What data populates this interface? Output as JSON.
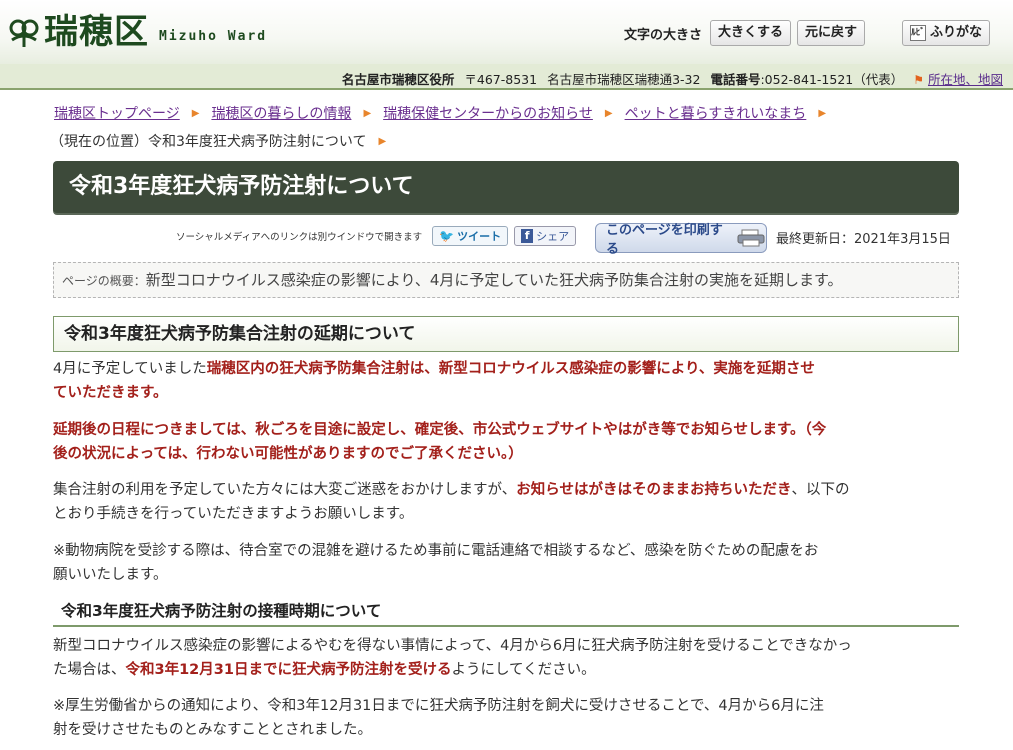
{
  "header": {
    "logo_title": "瑞穂区",
    "logo_sub": "Mizuho Ward",
    "textsize_label": "文字の大きさ",
    "enlarge_label": "大きくする",
    "reset_label": "元に戻す",
    "furigana_icon": "ﾙﾋﾞ",
    "furigana_label": "ふりがな"
  },
  "infobar": {
    "office": "名古屋市瑞穂区役所",
    "postal": "〒467-8531",
    "address": "名古屋市瑞穂区瑞穂通3-32",
    "phone_label": "電話番号",
    "phone": ":052-841-1521（代表）",
    "map_link": "所在地、地図"
  },
  "breadcrumb": {
    "items": [
      "瑞穂区トップページ",
      "瑞穂区の暮らしの情報",
      "瑞穂保健センターからのお知らせ",
      "ペットと暮らすきれいなまち"
    ],
    "current": "（現在の位置）令和3年度狂犬病予防注射について"
  },
  "page_title": "令和3年度狂犬病予防注射について",
  "social": {
    "note": "ソーシャルメディアへのリンクは別ウインドウで開きます",
    "tweet": "ツイート",
    "share": "シェア",
    "print": "このページを印刷する",
    "updated": "最終更新日：2021年3月15日"
  },
  "summary": {
    "label": "ページの概要：",
    "text": "新型コロナウイルス感染症の影響により、4月に予定していた狂犬病予防集合注射の実施を延期します。"
  },
  "section1": {
    "heading": "令和3年度狂犬病予防集合注射の延期について",
    "p1_a": "4月に予定していました",
    "p1_b": "瑞穂区内の狂犬病予防集合注射は、新型コロナウイルス感染症の影響により、実施を延期させ",
    "p1_c": "ていただきます。",
    "p2_a": "延期後の日程につきましては、秋ごろを目途に設定し、確定後、市公式ウェブサイトやはがき等でお知らせします。（今",
    "p2_b": "後の状況によっては、行わない可能性がありますのでご了承ください。）",
    "p3_a": "集合注射の利用を予定していた方々には大変ご迷惑をおかけしますが、",
    "p3_b": "お知らせはがきはそのままお持ちいただき",
    "p3_c": "、以下の",
    "p3_d": "とおり手続きを行っていただきますようお願いします。",
    "p4_a": "※動物病院を受診する際は、待合室での混雑を避けるため事前に電話連絡で相談するなど、感染を防ぐための配慮をお",
    "p4_b": "願いいたします。"
  },
  "section2": {
    "heading": "令和3年度狂犬病予防注射の接種時期について",
    "p1_a": "新型コロナウイルス感染症の影響によるやむを得ない事情によって、4月から6月に狂犬病予防注射を受けることできなかっ",
    "p1_b": "た場合は、",
    "p1_c": "令和3年12月31日までに狂犬病予防注射を受ける",
    "p1_d": "ようにしてください。",
    "p2_a": "※厚生労働省からの通知により、令和3年12月31日までに狂犬病予防注射を飼犬に受けさせることで、4月から6月に注",
    "p2_b": "射を受けさせたものとみなすこととされました。"
  },
  "colors": {
    "brand_green": "#1e4a1f",
    "title_bar": "#3d4a3a",
    "emphasis_red": "#a3201b",
    "link_purple": "#6a2f8f"
  }
}
